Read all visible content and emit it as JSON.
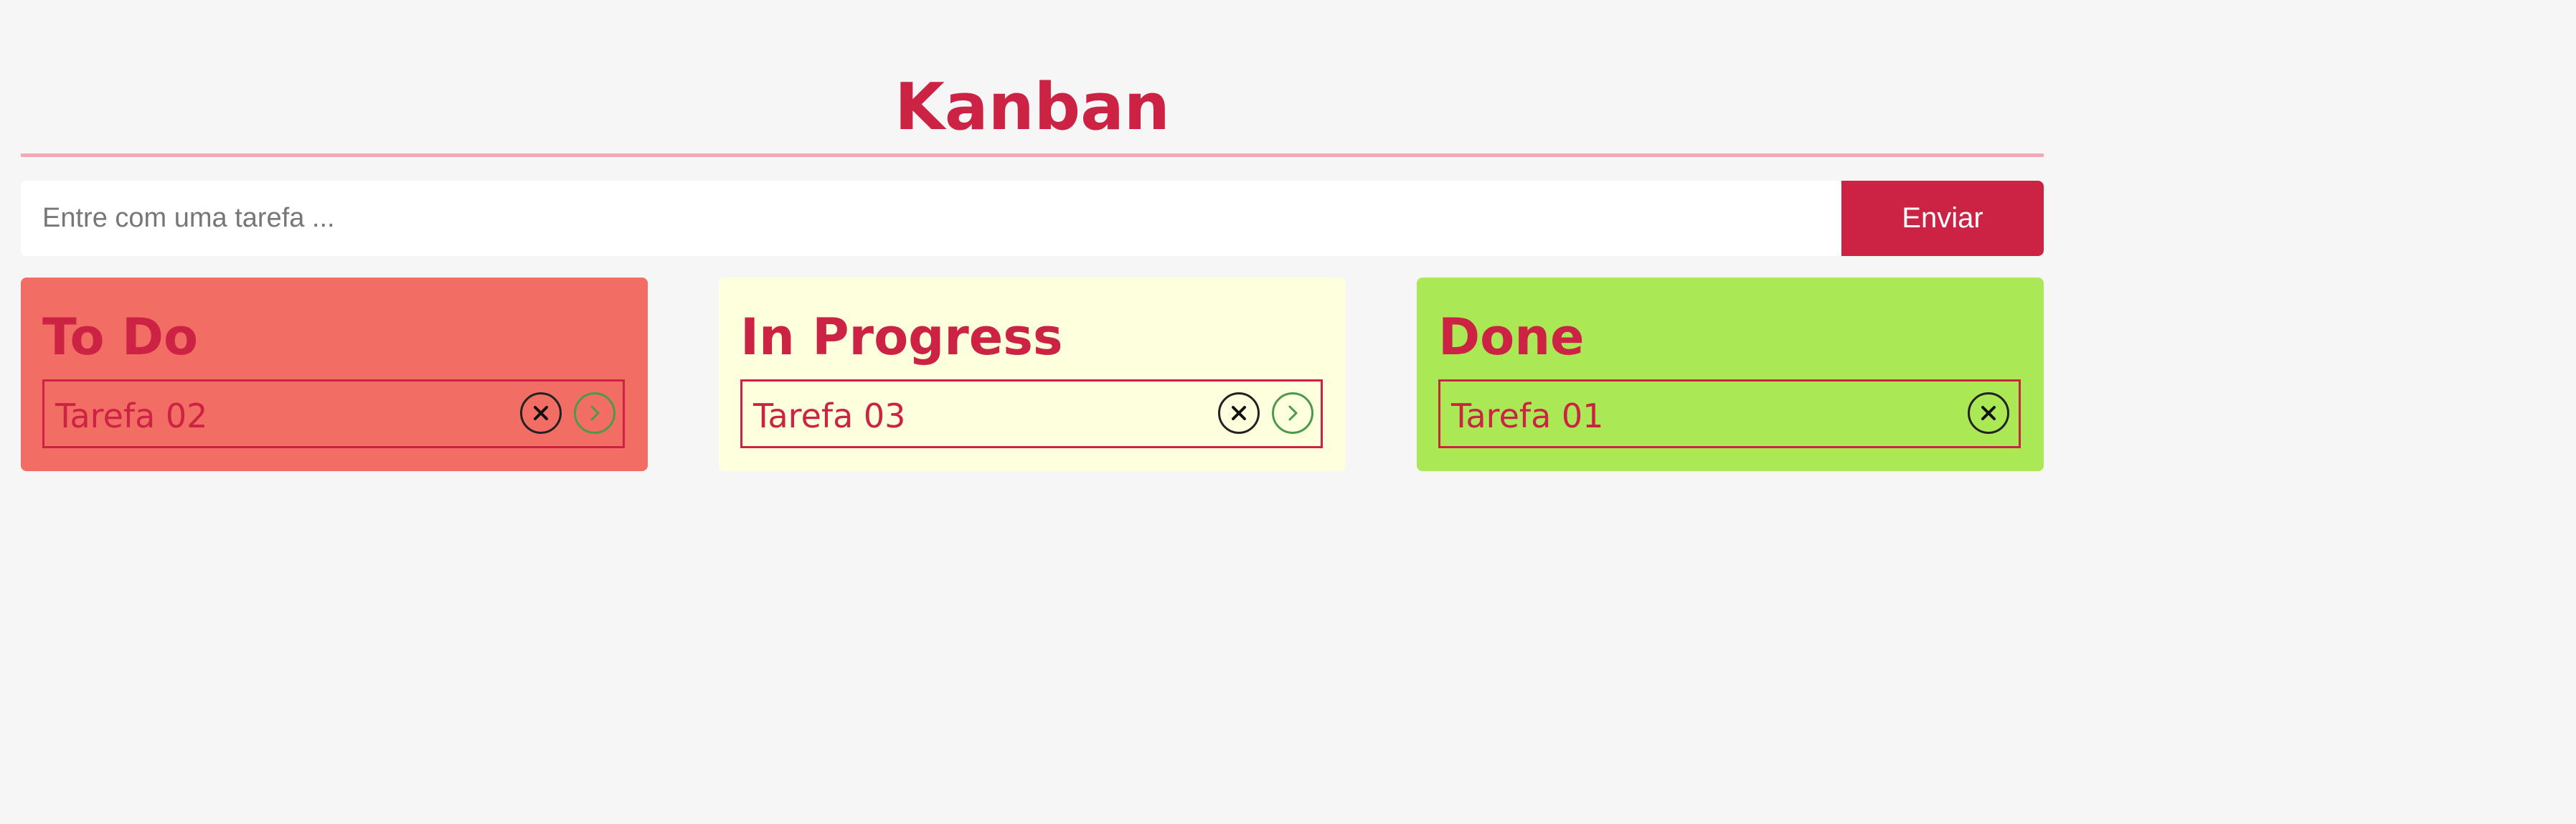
{
  "app": {
    "title": "Kanban"
  },
  "form": {
    "placeholder": "Entre com uma tarefa ...",
    "submit_label": "Enviar"
  },
  "columns": [
    {
      "title": "To Do",
      "color": "#f26d64",
      "cards": [
        {
          "label": "Tarefa 02",
          "actions": [
            "close-icon",
            "chevron-right-icon"
          ]
        }
      ]
    },
    {
      "title": "In Progress",
      "color": "#feffdc",
      "cards": [
        {
          "label": "Tarefa 03",
          "actions": [
            "close-icon",
            "chevron-right-icon"
          ]
        }
      ]
    },
    {
      "title": "Done",
      "color": "#abe855",
      "cards": [
        {
          "label": "Tarefa 01",
          "actions": [
            "close-icon"
          ]
        }
      ]
    }
  ],
  "colors": {
    "accent": "#cc2244",
    "divider": "#f3a9b6",
    "background": "#f6f6f6",
    "advance": "#4b9a4b"
  }
}
